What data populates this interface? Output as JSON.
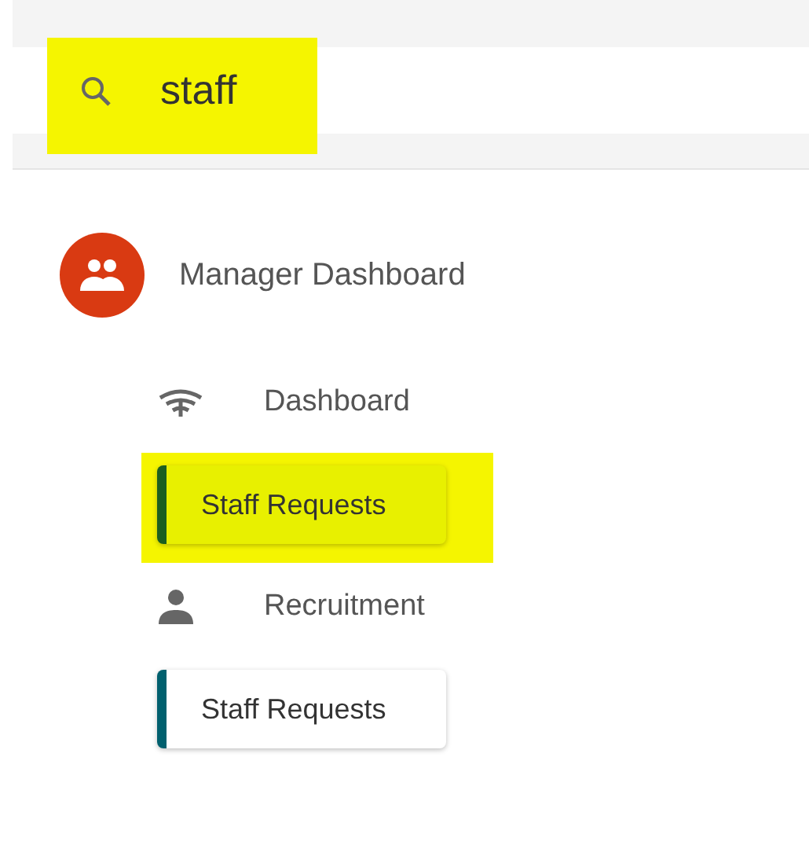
{
  "search": {
    "value": "staff",
    "highlighted": true
  },
  "section": {
    "title": "Manager Dashboard"
  },
  "items": [
    {
      "kind": "link",
      "label": "Dashboard",
      "highlighted": false
    },
    {
      "kind": "card",
      "label": "Staff Requests",
      "color": "#1b5e20",
      "highlighted": true
    },
    {
      "kind": "link",
      "label": "Recruitment",
      "highlighted": false
    },
    {
      "kind": "card",
      "label": "Staff Requests",
      "color": "#00606e",
      "highlighted": false
    }
  ]
}
